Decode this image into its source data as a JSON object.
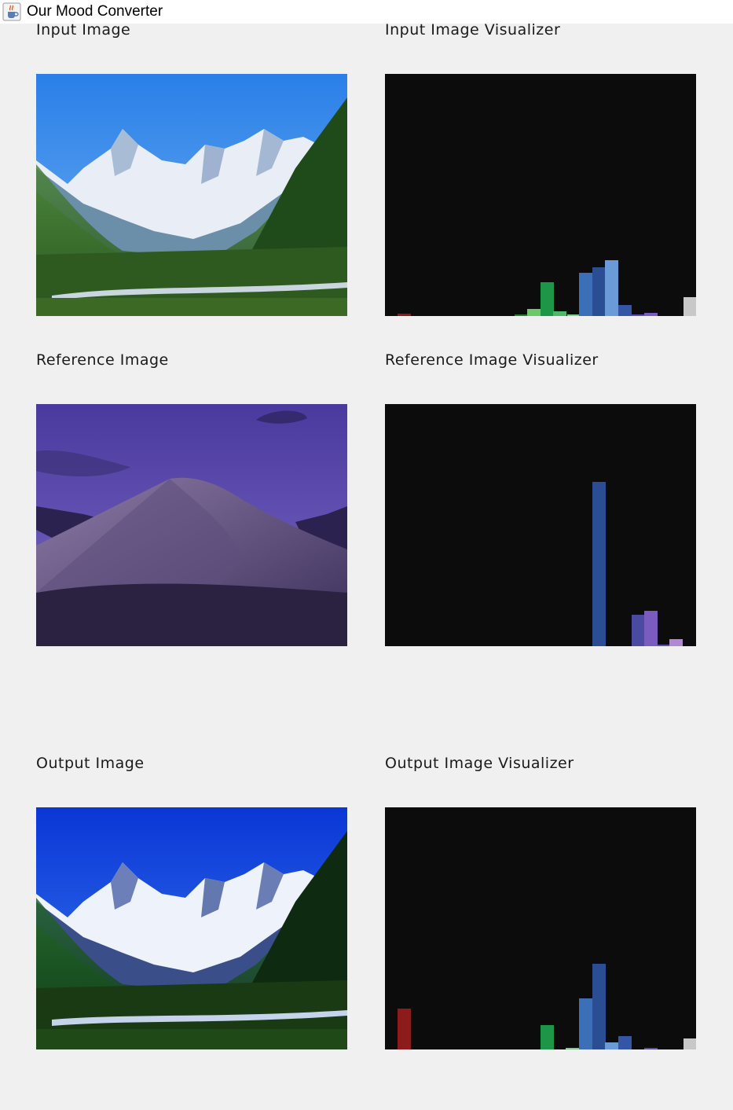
{
  "window": {
    "title": "Our Mood Converter",
    "icon": "java-cup-icon"
  },
  "panels": {
    "input_label": "Input Image",
    "input_viz_label": "Input Image Visualizer",
    "reference_label": "Reference Image",
    "reference_viz_label": "Reference Image Visualizer",
    "output_label": "Output Image",
    "output_viz_label": "Output Image Visualizer"
  },
  "chart_data": [
    {
      "type": "bar",
      "max": 1,
      "bars": [
        {
          "color": "#8e1b1b",
          "value": 0.01
        },
        {
          "color": "#2f7a33",
          "value": 0.005
        },
        {
          "color": "#6cc96a",
          "value": 0.03
        },
        {
          "color": "#1e9648",
          "value": 0.14
        },
        {
          "color": "#4db86a",
          "value": 0.02
        },
        {
          "color": "#7fcf8a",
          "value": 0.005
        },
        {
          "color": "#3b6fb8",
          "value": 0.18
        },
        {
          "color": "#2a4d94",
          "value": 0.2
        },
        {
          "color": "#6a9ad8",
          "value": 0.23
        },
        {
          "color": "#3556a6",
          "value": 0.045
        },
        {
          "color": "#5a4ea8",
          "value": 0.008
        },
        {
          "color": "#7a5cc0",
          "value": 0.012
        },
        {
          "color": "#c8c8c8",
          "value": 0.078
        }
      ]
    },
    {
      "type": "bar",
      "max": 1,
      "bars": [
        {
          "color": "#2a4d94",
          "value": 0.68
        },
        {
          "color": "#4a4aa0",
          "value": 0.13
        },
        {
          "color": "#7a5cc0",
          "value": 0.145
        },
        {
          "color": "#5a4ea8",
          "value": 0.008
        },
        {
          "color": "#b08ad0",
          "value": 0.03
        }
      ]
    },
    {
      "type": "bar",
      "max": 1,
      "bars": [
        {
          "color": "#8e1b1b",
          "value": 0.17
        },
        {
          "color": "#1e9648",
          "value": 0.1
        },
        {
          "color": "#7fcf8a",
          "value": 0.006
        },
        {
          "color": "#3b6fb8",
          "value": 0.21
        },
        {
          "color": "#2a4d94",
          "value": 0.355
        },
        {
          "color": "#6a9ad8",
          "value": 0.03
        },
        {
          "color": "#3556a6",
          "value": 0.055
        },
        {
          "color": "#5a4ea8",
          "value": 0.006
        },
        {
          "color": "#c8c8c8",
          "value": 0.045
        }
      ]
    }
  ]
}
